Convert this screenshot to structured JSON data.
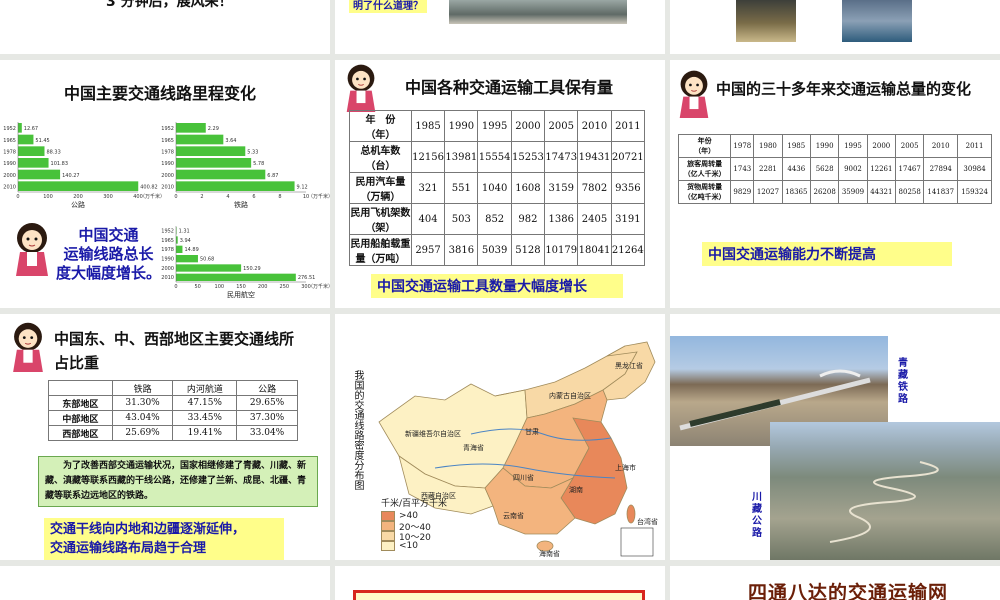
{
  "row1": {
    "s1_text": "3 分钟后，展风采！",
    "s2_text": "明了什么道理？"
  },
  "s4": {
    "title": "中国主要交通线路里程变化",
    "callout": [
      "中国交通",
      "运输线路总长",
      "度大幅度增长。"
    ],
    "chart_data": [
      {
        "type": "bar",
        "title": "",
        "xlabel": "公路",
        "unit": "（万千米）",
        "categories": [
          "1952",
          "1965",
          "1978",
          "1990",
          "2000",
          "2010"
        ],
        "values": [
          12.67,
          51.45,
          88.33,
          101.83,
          140.27,
          400.82
        ],
        "xlim": [
          0,
          400
        ],
        "ticks": [
          "0",
          "100",
          "200",
          "300",
          "400"
        ]
      },
      {
        "type": "bar",
        "title": "",
        "xlabel": "铁路",
        "unit": "（万千米）",
        "categories": [
          "1952",
          "1965",
          "1978",
          "1990",
          "2000",
          "2010"
        ],
        "values": [
          2.29,
          3.64,
          5.33,
          5.78,
          6.87,
          9.12
        ],
        "xlim": [
          0,
          10
        ],
        "ticks": [
          "0",
          "2",
          "4",
          "6",
          "8",
          "10"
        ]
      },
      {
        "type": "bar",
        "title": "",
        "xlabel": "民用航空",
        "unit": "（万千米）",
        "categories": [
          "1952",
          "1965",
          "1978",
          "1990",
          "2000",
          "2010"
        ],
        "values": [
          1.31,
          3.94,
          14.89,
          50.68,
          150.29,
          276.51
        ],
        "xlim": [
          0,
          300
        ],
        "ticks": [
          "0",
          "50",
          "100",
          "150",
          "200",
          "250",
          "300"
        ]
      }
    ]
  },
  "s5": {
    "title": "中国各种交通运输工具保有量",
    "headers": [
      "年　份\n（年）",
      "1985",
      "1990",
      "1995",
      "2000",
      "2005",
      "2010",
      "2011"
    ],
    "rows": [
      [
        "总机车数\n（台）",
        "12156",
        "13981",
        "15554",
        "15253",
        "17473",
        "19431",
        "20721"
      ],
      [
        "民用汽车量\n（万辆）",
        "321",
        "551",
        "1040",
        "1608",
        "3159",
        "7802",
        "9356"
      ],
      [
        "民用飞机架数\n（架）",
        "404",
        "503",
        "852",
        "982",
        "1386",
        "2405",
        "3191"
      ],
      [
        "民用船舶载重\n量（万吨）",
        "2957",
        "3816",
        "5039",
        "5128",
        "10179",
        "18041",
        "21264"
      ]
    ],
    "highlight": "中国交通运输工具数量大幅度增长"
  },
  "s6": {
    "title": "中国的三十多年来交通运输总量的变化",
    "headers": [
      "年份\n（年）",
      "1978",
      "1980",
      "1985",
      "1990",
      "1995",
      "2000",
      "2005",
      "2010",
      "2011"
    ],
    "rows": [
      [
        "旅客周转量\n（亿人千米）",
        "1743",
        "2281",
        "4436",
        "5628",
        "9002",
        "12261",
        "17467",
        "27894",
        "30984"
      ],
      [
        "货物周转量\n（亿吨千米）",
        "9829",
        "12027",
        "18365",
        "26208",
        "35909",
        "44321",
        "80258",
        "141837",
        "159324"
      ]
    ],
    "highlight": "中国交通运输能力不断提高"
  },
  "s7": {
    "title_line1": "中国东、中、西部地区主要交通线所",
    "title_line2": "占比重",
    "headers": [
      "",
      "铁路",
      "内河航道",
      "公路"
    ],
    "rows": [
      [
        "东部地区",
        "31.30%",
        "47.15%",
        "29.65%"
      ],
      [
        "中部地区",
        "43.04%",
        "33.45%",
        "37.30%"
      ],
      [
        "西部地区",
        "25.69%",
        "19.41%",
        "33.04%"
      ]
    ],
    "note": "为了改善西部交通运输状况，国家相继修建了青藏、川藏、新藏、滇藏等联系西藏的干线公路，还修建了兰新、成昆、北疆、青藏等联系边远地区的铁路。",
    "highlight_lines": [
      "交通干线向内地和边疆逐渐延伸，",
      "交通运输线路布局趋于合理"
    ]
  },
  "s8": {
    "vertical_title": "我国的交通线路密度分布图",
    "legend_title": "千米/百平方千米",
    "legend": [
      {
        "label": ">40",
        "color": "#e8885a"
      },
      {
        "label": "20～40",
        "color": "#f3b47e"
      },
      {
        "label": "10～20",
        "color": "#f8d9a6"
      },
      {
        "label": "<10",
        "color": "#fdf1c4"
      }
    ],
    "regions": [
      "新疆维吾尔自治区",
      "西藏自治区",
      "青海省",
      "内蒙古自治区",
      "黑龙江省",
      "四川省",
      "云南省",
      "甘肃",
      "湖南",
      "台湾省",
      "海南省",
      "上海市"
    ]
  },
  "s9": {
    "label_rail": "青藏铁路",
    "label_road": "川藏公路"
  },
  "row4": {
    "s12_text": "四通八达的交通运输网"
  }
}
